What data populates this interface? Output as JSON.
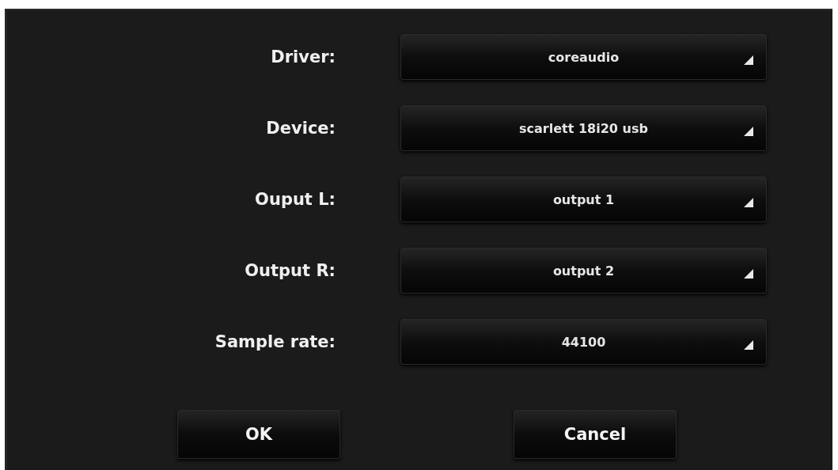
{
  "settings": [
    {
      "label": "Driver:",
      "value": "coreaudio"
    },
    {
      "label": "Device:",
      "value": "scarlett 18i20 usb"
    },
    {
      "label": "Ouput L:",
      "value": "output 1"
    },
    {
      "label": "Output R:",
      "value": "output 2"
    },
    {
      "label": "Sample rate:",
      "value": "44100"
    }
  ],
  "buttons": [
    "OK",
    "Cancel"
  ]
}
